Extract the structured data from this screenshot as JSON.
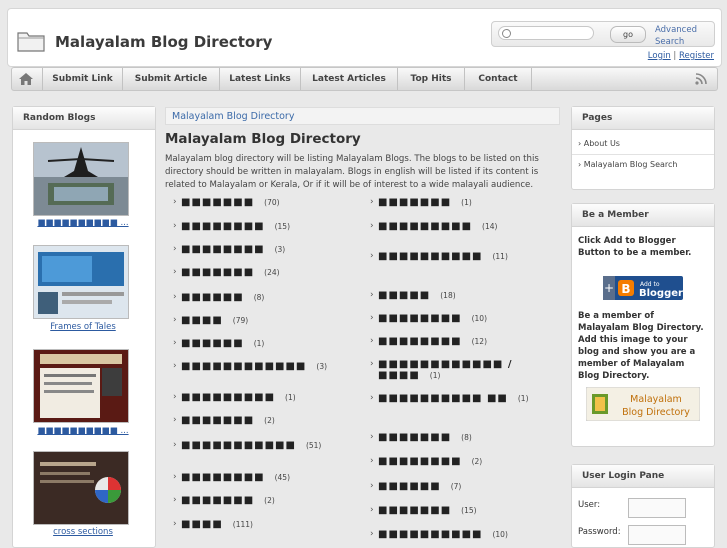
{
  "header": {
    "site_title": "Malayalam Blog Directory",
    "search_placeholder": "",
    "go_label": "go",
    "advanced_search": "Advanced Search",
    "login": "Login",
    "separator": "|",
    "register": "Register"
  },
  "nav": {
    "items": [
      "Submit Link",
      "Submit Article",
      "Latest Links",
      "Latest Articles",
      "Top Hits",
      "Contact"
    ]
  },
  "left": {
    "title": "Random Blogs",
    "captions": [
      "■■■■■■■■■■ ...",
      "Frames of Tales",
      "■■■■■■■■■■ ...",
      "cross sections"
    ]
  },
  "main": {
    "crumb": "Malayalam Blog Directory",
    "title": "Malayalam Blog Directory",
    "desc": "Malayalam blog directory will be listing Malayalam Blogs. The blogs to be listed on this directory should be written in malayalam. Blogs in english will be listed if its content is related to Malayalam or Kerala, Or if it will be of interest to a wide malayali audience.",
    "left_cats": [
      {
        "name": "■■■■■■■",
        "count": "(70)"
      },
      {
        "name": "■■■■■■■■",
        "count": "(15)"
      },
      {
        "name": "■■■■■■■■",
        "count": "(3)"
      },
      {
        "name": "■■■■■■■",
        "count": "(24)"
      },
      {
        "name": "■■■■■■",
        "count": "(8)"
      },
      {
        "name": "■■■■",
        "count": "(79)"
      },
      {
        "name": "■■■■■■",
        "count": "(1)"
      },
      {
        "name": "■■■■■■■■■■■■",
        "count": "(3)"
      },
      {
        "name": "■■■■■■■■■",
        "count": "(1)"
      },
      {
        "name": "■■■■■■■",
        "count": "(2)"
      },
      {
        "name": "■■■■■■■■■■■",
        "count": "(51)"
      },
      {
        "name": "■■■■■■■■",
        "count": "(45)"
      },
      {
        "name": "■■■■■■■",
        "count": "(2)"
      },
      {
        "name": "■■■■",
        "count": "(111)"
      }
    ],
    "right_cats": [
      {
        "name": "■■■■■■■",
        "count": "(1)"
      },
      {
        "name": "■■■■■■■■■",
        "count": "(14)"
      },
      {
        "name": "■■■■■■■■■■",
        "count": "(11)"
      },
      {
        "name": "■■■■■",
        "count": "(18)"
      },
      {
        "name": "■■■■■■■■",
        "count": "(10)"
      },
      {
        "name": "■■■■■■■■",
        "count": "(12)"
      },
      {
        "name": "■■■■■■■■■■■■ / ■■■■",
        "count": "(1)"
      },
      {
        "name": "■■■■■■■■■■ ■■",
        "count": "(1)"
      },
      {
        "name": "■■■■■■■",
        "count": "(8)"
      },
      {
        "name": "■■■■■■■■",
        "count": "(2)"
      },
      {
        "name": "■■■■■■",
        "count": "(7)"
      },
      {
        "name": "■■■■■■■",
        "count": "(15)"
      },
      {
        "name": "■■■■■■■■■■",
        "count": "(10)"
      }
    ]
  },
  "right": {
    "pages_title": "Pages",
    "pages": [
      "About Us",
      "Malayalam Blog Search"
    ],
    "member_title": "Be a Member",
    "member_text1": "Click Add to Blogger Button to be a member.",
    "blogger_small": "Add to",
    "blogger_big": "Blogger",
    "member_text2": "Be a member of Malayalam Blog Directory. Add this image to your blog and show you are a member of Malayalam Blog Directory.",
    "badge_line1": "Malayalam",
    "badge_line2": "Blog Directory",
    "login_title": "User Login Pane",
    "user_label": "User:",
    "pass_label": "Password:"
  }
}
